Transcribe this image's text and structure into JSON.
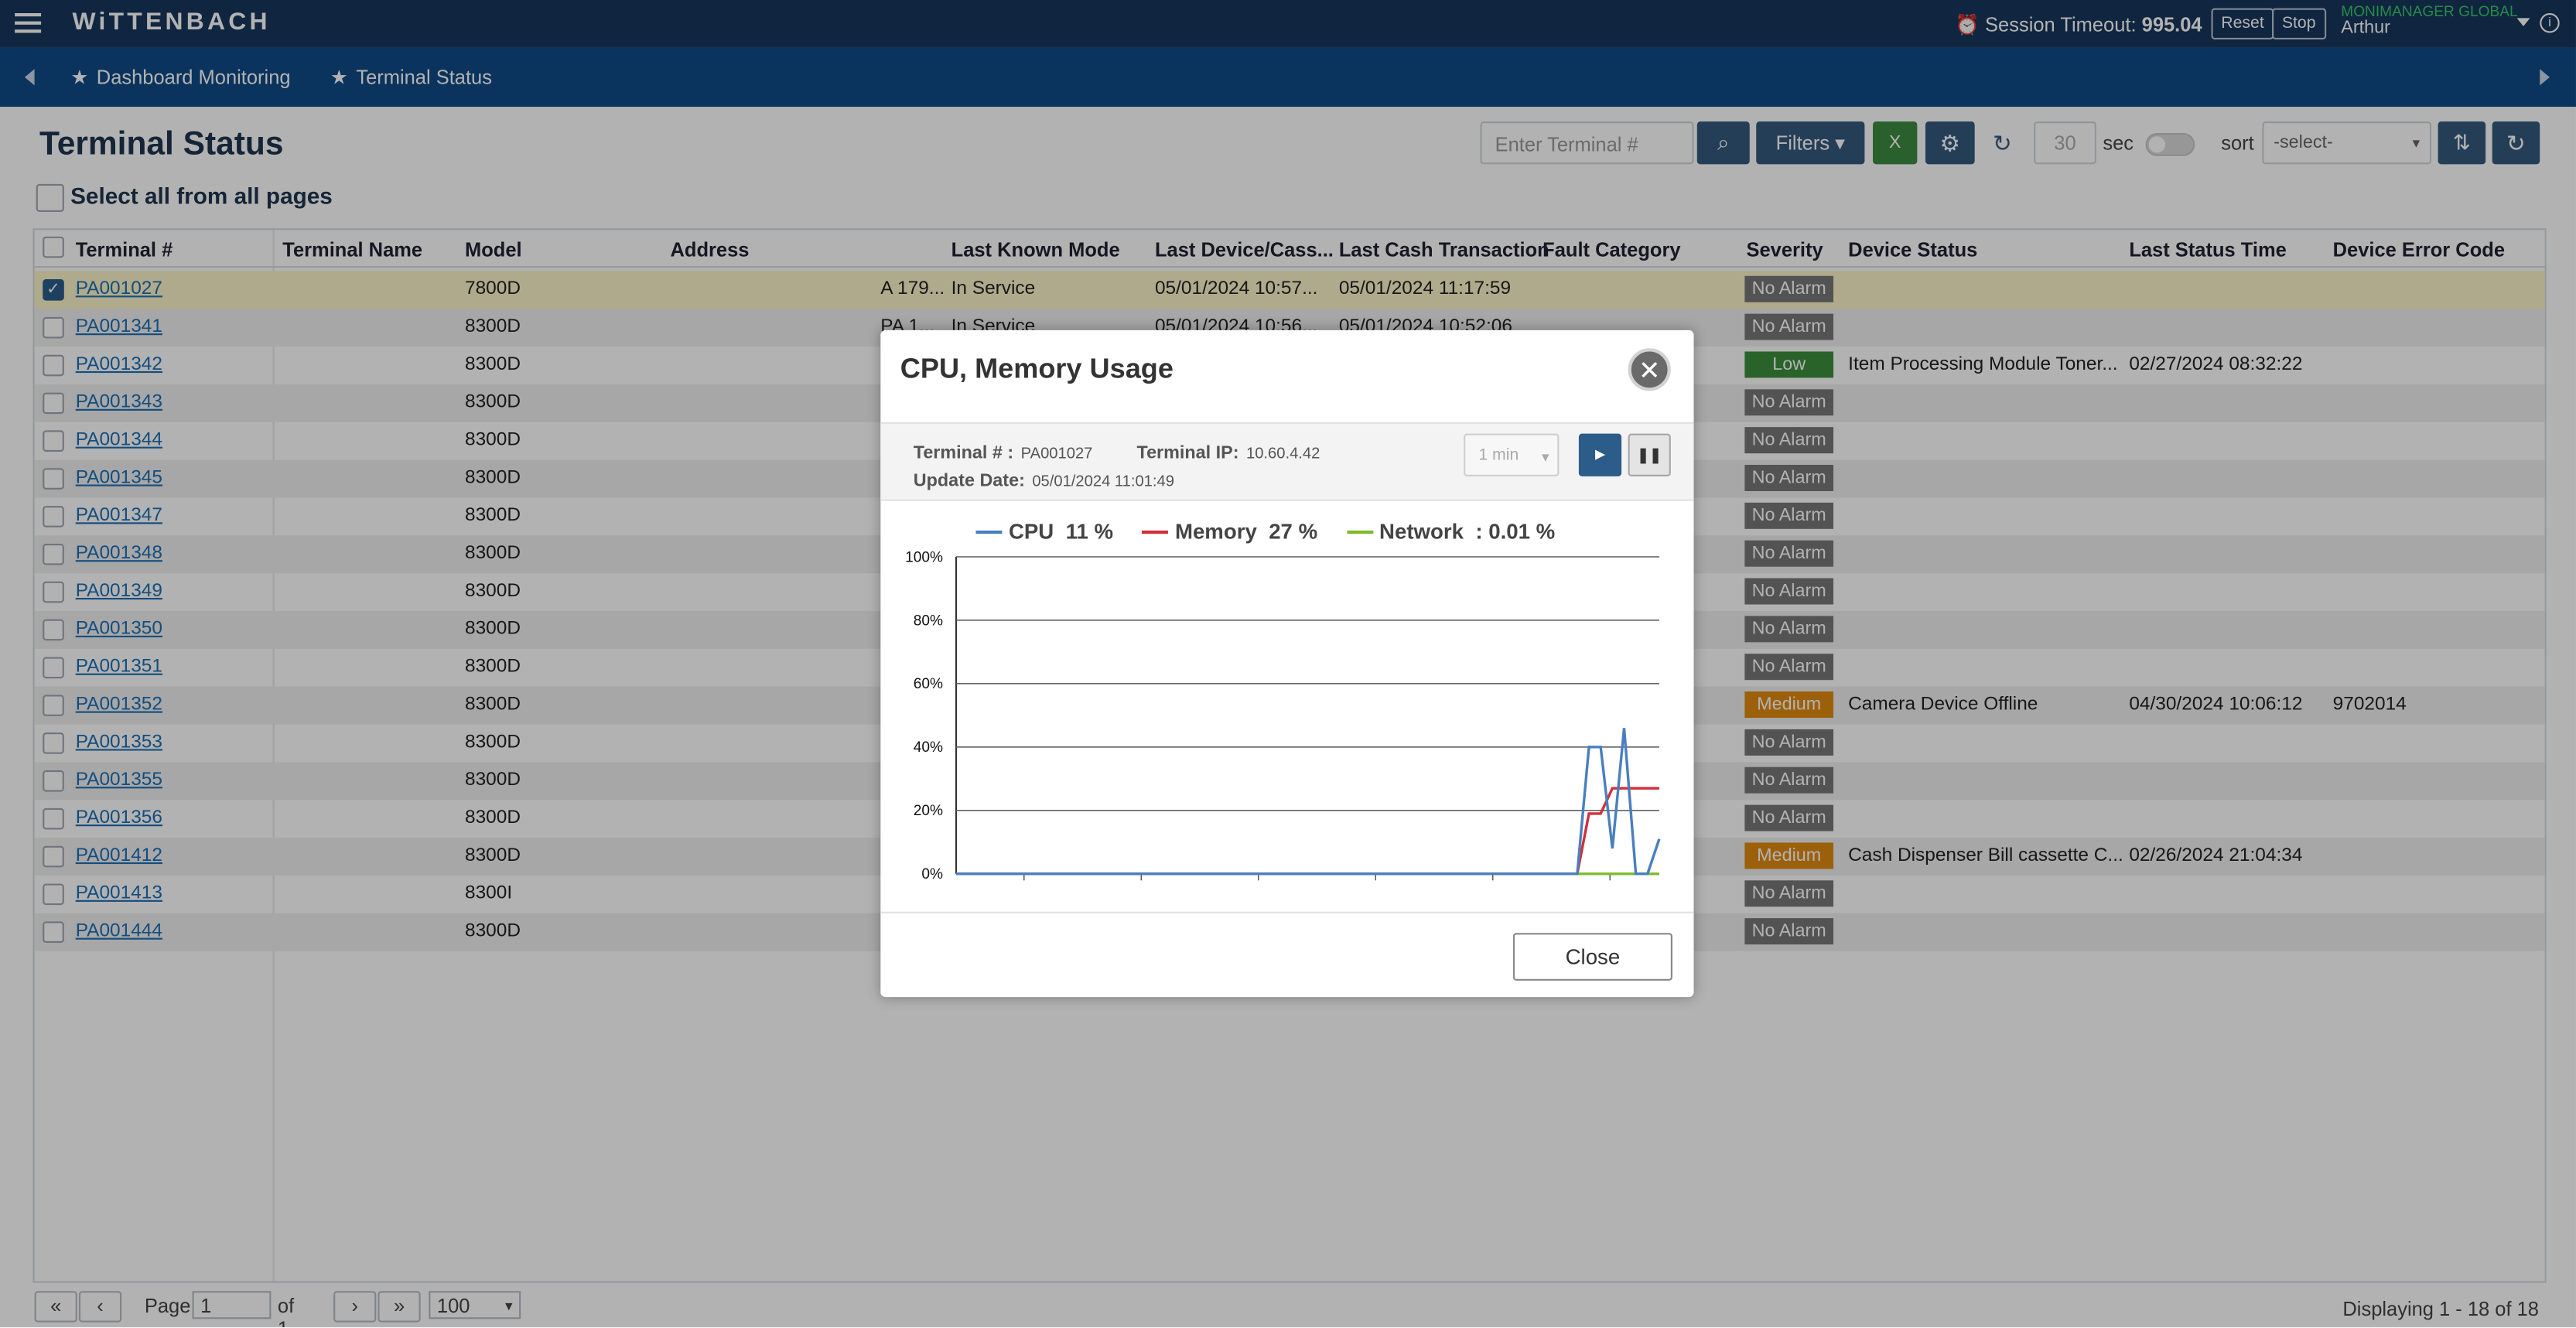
{
  "app": {
    "brand": "WiTTENBACH",
    "session_label": "Session Timeout:",
    "session_value": "995.04",
    "reset_label": "Reset",
    "stop_label": "Stop",
    "org": "MONIMANAGER GLOBAL",
    "user": "Arthur"
  },
  "nav": {
    "crumbs": [
      "Dashboard Monitoring",
      "Terminal Status"
    ]
  },
  "page": {
    "title": "Terminal Status",
    "select_all_label": "Select all from all pages"
  },
  "toolbar": {
    "search_placeholder": "Enter Terminal #",
    "filters_label": "Filters",
    "refresh_interval": "30",
    "sec_label": "sec",
    "sort_label": "sort",
    "sort_value": "-select-"
  },
  "table": {
    "columns": [
      "Terminal #",
      "Terminal Name",
      "Model",
      "Address",
      "Last Known Mode",
      "Last Device/Cass...",
      "Last Cash Transaction",
      "Fault Category",
      "Severity",
      "Device Status",
      "Last Status Time",
      "Device Error Code"
    ],
    "rows": [
      {
        "terminal": "PA001027",
        "model": "7800D",
        "address": "A 179...",
        "mode": "In Service",
        "last_device": "05/01/2024 10:57...",
        "last_cash": "05/01/2024 11:17:59",
        "severity": "No Alarm",
        "severity_level": "none",
        "device_status": "",
        "last_status_time": "",
        "error_code": ""
      },
      {
        "terminal": "PA001341",
        "model": "8300D",
        "address": "PA 1...",
        "mode": "In Service",
        "last_device": "05/01/2024 10:56...",
        "last_cash": "05/01/2024 10:52:06",
        "severity": "No Alarm",
        "severity_level": "none",
        "device_status": "",
        "last_status_time": "",
        "error_code": ""
      },
      {
        "terminal": "PA001342",
        "model": "8300D",
        "severity": "Low",
        "severity_level": "low",
        "device_status": "Item Processing Module Toner...",
        "last_status_time": "02/27/2024 08:32:22",
        "error_code": ""
      },
      {
        "terminal": "PA001343",
        "model": "8300D",
        "severity": "No Alarm",
        "severity_level": "none"
      },
      {
        "terminal": "PA001344",
        "model": "8300D",
        "severity": "No Alarm",
        "severity_level": "none"
      },
      {
        "terminal": "PA001345",
        "model": "8300D",
        "severity": "No Alarm",
        "severity_level": "none"
      },
      {
        "terminal": "PA001347",
        "model": "8300D",
        "severity": "No Alarm",
        "severity_level": "none"
      },
      {
        "terminal": "PA001348",
        "model": "8300D",
        "severity": "No Alarm",
        "severity_level": "none"
      },
      {
        "terminal": "PA001349",
        "model": "8300D",
        "severity": "No Alarm",
        "severity_level": "none"
      },
      {
        "terminal": "PA001350",
        "model": "8300D",
        "severity": "No Alarm",
        "severity_level": "none"
      },
      {
        "terminal": "PA001351",
        "model": "8300D",
        "severity": "No Alarm",
        "severity_level": "none"
      },
      {
        "terminal": "PA001352",
        "model": "8300D",
        "severity": "Medium",
        "severity_level": "medium",
        "device_status": "Camera Device Offline",
        "last_status_time": "04/30/2024 10:06:12",
        "error_code": "9702014"
      },
      {
        "terminal": "PA001353",
        "model": "8300D",
        "severity": "No Alarm",
        "severity_level": "none"
      },
      {
        "terminal": "PA001355",
        "model": "8300D",
        "severity": "No Alarm",
        "severity_level": "none"
      },
      {
        "terminal": "PA001356",
        "model": "8300D",
        "severity": "No Alarm",
        "severity_level": "none"
      },
      {
        "terminal": "PA001412",
        "model": "8300D",
        "severity": "Medium",
        "severity_level": "medium",
        "device_status": "Cash Dispenser Bill cassette C...",
        "last_status_time": "02/26/2024 21:04:34",
        "error_code": ""
      },
      {
        "terminal": "PA001413",
        "model": "8300I",
        "severity": "No Alarm",
        "severity_level": "none"
      },
      {
        "terminal": "PA001444",
        "model": "8300D",
        "severity": "No Alarm",
        "severity_level": "none"
      }
    ]
  },
  "pager": {
    "page_label": "Page",
    "page_value": "1",
    "of_label": "of 1",
    "page_size": "100",
    "displaying": "Displaying 1 - 18 of 18"
  },
  "modal": {
    "title": "CPU, Memory Usage",
    "terminal_label": "Terminal # :",
    "terminal_value": "PA001027",
    "ip_label": "Terminal IP:",
    "ip_value": "10.60.4.42",
    "update_label": "Update Date:",
    "update_value": "05/01/2024 11:01:49",
    "interval": "1 min",
    "close_label": "Close"
  },
  "colors": {
    "cpu": "#4a7fbf",
    "memory": "#d0303a",
    "network": "#7fba2b",
    "severity_none": "#777777",
    "severity_low": "#3b8e3d",
    "severity_medium": "#e08a11"
  },
  "chart_data": {
    "type": "line",
    "ylim": [
      0,
      100
    ],
    "yticks": [
      "0%",
      "20%",
      "40%",
      "60%",
      "80%",
      "100%"
    ],
    "legend": [
      {
        "name": "CPU",
        "value": "11 %"
      },
      {
        "name": "Memory",
        "value": "27 %"
      },
      {
        "name": "Network",
        "value": ": 0.01 %"
      }
    ],
    "x": [
      0,
      1,
      2,
      3,
      4,
      5,
      6,
      7,
      8,
      9,
      10,
      11,
      12,
      13,
      14,
      15,
      16,
      17,
      18,
      19,
      20,
      21,
      22,
      23,
      24,
      25,
      26,
      27,
      28,
      29,
      30,
      31,
      32,
      33,
      34,
      35,
      36,
      37,
      38,
      39,
      40,
      41,
      42,
      43,
      44,
      45,
      46,
      47,
      48,
      49,
      50,
      51,
      52,
      53,
      54,
      55,
      56,
      57,
      58,
      59,
      60
    ],
    "series": [
      {
        "name": "CPU",
        "values": [
          0,
          0,
          0,
          0,
          0,
          0,
          0,
          0,
          0,
          0,
          0,
          0,
          0,
          0,
          0,
          0,
          0,
          0,
          0,
          0,
          0,
          0,
          0,
          0,
          0,
          0,
          0,
          0,
          0,
          0,
          0,
          0,
          0,
          0,
          0,
          0,
          0,
          0,
          0,
          0,
          0,
          0,
          0,
          0,
          0,
          0,
          0,
          0,
          0,
          0,
          0,
          0,
          0,
          0,
          40,
          40,
          8,
          46,
          0,
          0,
          11
        ]
      },
      {
        "name": "Memory",
        "values": [
          0,
          0,
          0,
          0,
          0,
          0,
          0,
          0,
          0,
          0,
          0,
          0,
          0,
          0,
          0,
          0,
          0,
          0,
          0,
          0,
          0,
          0,
          0,
          0,
          0,
          0,
          0,
          0,
          0,
          0,
          0,
          0,
          0,
          0,
          0,
          0,
          0,
          0,
          0,
          0,
          0,
          0,
          0,
          0,
          0,
          0,
          0,
          0,
          0,
          0,
          0,
          0,
          0,
          0,
          19,
          19,
          27,
          27,
          27,
          27,
          27
        ]
      },
      {
        "name": "Network",
        "values": [
          0,
          0,
          0,
          0,
          0,
          0,
          0,
          0,
          0,
          0,
          0,
          0,
          0,
          0,
          0,
          0,
          0,
          0,
          0,
          0,
          0,
          0,
          0,
          0,
          0,
          0,
          0,
          0,
          0,
          0,
          0,
          0,
          0,
          0,
          0,
          0,
          0,
          0,
          0,
          0,
          0,
          0,
          0,
          0,
          0,
          0,
          0,
          0,
          0,
          0,
          0,
          0,
          0,
          0,
          0,
          0,
          0,
          0,
          0,
          0,
          0
        ]
      }
    ]
  }
}
